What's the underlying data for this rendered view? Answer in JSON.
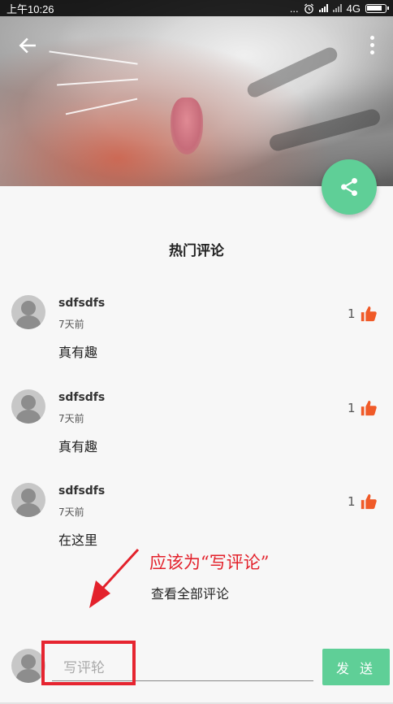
{
  "status_bar": {
    "time": "上午10:26",
    "dots": "...",
    "network": "4G"
  },
  "header": {
    "back_icon": "arrow-left-icon",
    "more_icon": "more-vertical-icon",
    "share_icon": "share-icon"
  },
  "section": {
    "title": "热门评论"
  },
  "comments": [
    {
      "name": "sdfsdfs",
      "time": "7天前",
      "text": "真有趣",
      "likes": "1"
    },
    {
      "name": "sdfsdfs",
      "time": "7天前",
      "text": "真有趣",
      "likes": "1"
    },
    {
      "name": "sdfsdfs",
      "time": "7天前",
      "text": "在这里",
      "likes": "1"
    }
  ],
  "view_all": "查看全部评论",
  "annotation": "应该为“写评论”",
  "composer": {
    "placeholder": "写评轮",
    "send_label": "发 送"
  },
  "colors": {
    "accent": "#5fcf97",
    "like": "#f05a28",
    "annotation": "#e3212b"
  }
}
